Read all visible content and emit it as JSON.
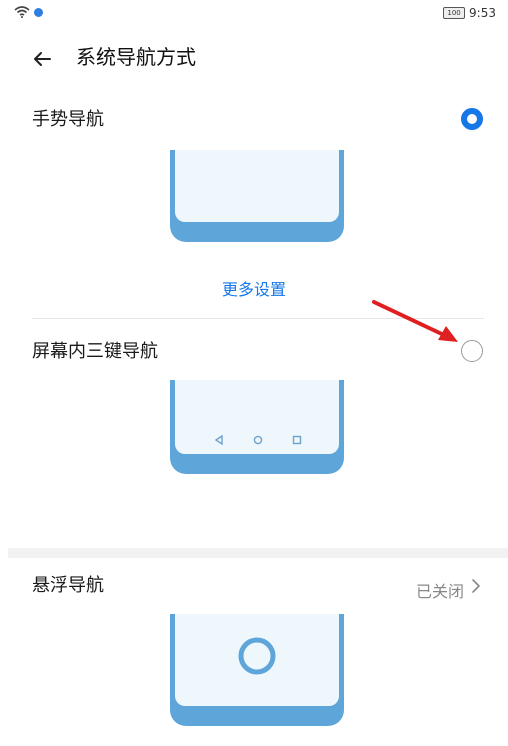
{
  "status_bar": {
    "time": "9:53",
    "battery": "100"
  },
  "header": {
    "title": "系统导航方式"
  },
  "gesture": {
    "title": "手势导航",
    "selected": true,
    "more_settings_label": "更多设置"
  },
  "three_key": {
    "title": "屏幕内三键导航",
    "selected": false
  },
  "floating": {
    "title": "悬浮导航",
    "status": "已关闭"
  },
  "colors": {
    "accent": "#1677e8",
    "phone_frame": "#5ea5da",
    "phone_screen": "#eef7fc",
    "arrow": "#e02020"
  },
  "icons": [
    "wifi-icon",
    "back-arrow-icon",
    "chevron-right-icon",
    "nav-back-icon",
    "nav-home-icon",
    "nav-recent-icon",
    "float-ring-icon",
    "red-arrow-annotation"
  ]
}
